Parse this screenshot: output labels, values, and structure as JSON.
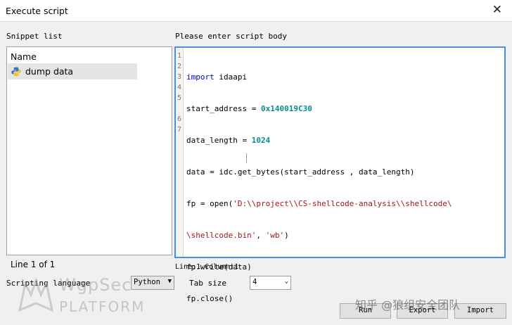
{
  "window": {
    "title": "Execute script"
  },
  "snippet_list": {
    "label": "Snippet list",
    "column_header": "Name",
    "items": [
      {
        "label": "dump data"
      }
    ],
    "line_info": "Line 1 of 1"
  },
  "editor": {
    "label": "Please enter script body",
    "status": "Line:1  Column:1"
  },
  "scripting_language": {
    "label": "Scripting language",
    "value": "Python"
  },
  "tab_size": {
    "label": "Tab size",
    "value": "4"
  },
  "buttons": {
    "run": "Run",
    "export": "Export",
    "import": "Import"
  },
  "watermark": {
    "brand_line1": "WgpSec",
    "brand_line2": "PLATFORM",
    "zhihu": "知乎 @狼组安全团队"
  },
  "code_lines": {
    "l1": {
      "num": "1",
      "kw": "import",
      "rest": " idaapi"
    },
    "l2": {
      "num": "2",
      "a": "start_address = ",
      "hex": "0x140019C30"
    },
    "l3": {
      "num": "3",
      "a": "data_length = ",
      "hex": "1024"
    },
    "l4": {
      "num": "4",
      "a": "data = idc.get_bytes(start_address , data_length)"
    },
    "l5": {
      "num": "5",
      "a": "fp = open(",
      "str": "'D:\\\\project\\\\CS-shellcode-analysis\\\\shellcode\\"
    },
    "l5b": {
      "str": "\\shellcode.bin'",
      "mid": ", ",
      "str2": "'wb'",
      "end": ")"
    },
    "l6": {
      "num": "6",
      "a": "fp.write(data)"
    },
    "l7": {
      "num": "7",
      "a": "fp.close()"
    }
  }
}
